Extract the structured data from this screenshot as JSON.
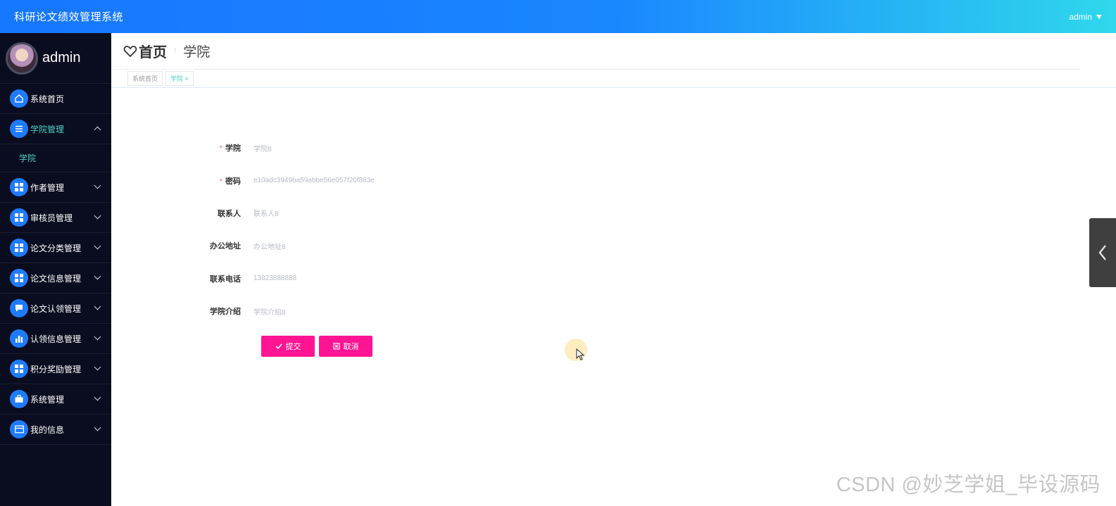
{
  "header": {
    "app_title": "科研论文绩效管理系统",
    "user_label": "admin"
  },
  "sidebar": {
    "profile_name": "admin",
    "items": [
      {
        "label": "系统首页",
        "icon": "home-icon"
      },
      {
        "label": "学院管理",
        "icon": "list-icon",
        "open": true,
        "active": true,
        "children": [
          {
            "label": "学院"
          }
        ]
      },
      {
        "label": "作者管理",
        "icon": "grid-icon"
      },
      {
        "label": "审核员管理",
        "icon": "grid-icon"
      },
      {
        "label": "论文分类管理",
        "icon": "grid-icon"
      },
      {
        "label": "论文信息管理",
        "icon": "grid-icon"
      },
      {
        "label": "论文认领管理",
        "icon": "chat-icon"
      },
      {
        "label": "认领信息管理",
        "icon": "bar-chart-icon"
      },
      {
        "label": "积分奖励管理",
        "icon": "grid-icon"
      },
      {
        "label": "系统管理",
        "icon": "briefcase-icon"
      },
      {
        "label": "我的信息",
        "icon": "card-icon"
      }
    ]
  },
  "breadcrumb": {
    "home": "首页",
    "current": "学院"
  },
  "tags": {
    "home": "系统首页",
    "current": "学院",
    "close": "×"
  },
  "form": {
    "fields": [
      {
        "label": "学院",
        "required": true,
        "value": "学院8"
      },
      {
        "label": "密码",
        "required": true,
        "value": "e10adc3949ba59abbe56e057f20f883e"
      },
      {
        "label": "联系人",
        "required": false,
        "value": "联系人8"
      },
      {
        "label": "办公地址",
        "required": false,
        "value": "办公地址8"
      },
      {
        "label": "联系电话",
        "required": false,
        "value": "13823888888"
      },
      {
        "label": "学院介绍",
        "required": false,
        "value": "学院介绍8"
      }
    ],
    "required_mark": "*",
    "submit_label": "提交",
    "cancel_label": "取消"
  },
  "watermark": "CSDN @妙芝学姐_毕设源码",
  "colors": {
    "accent": "#1677ff",
    "sidebar_bg": "#0a0d1f",
    "active_text": "#4fd1c5",
    "button": "#ff1493"
  }
}
